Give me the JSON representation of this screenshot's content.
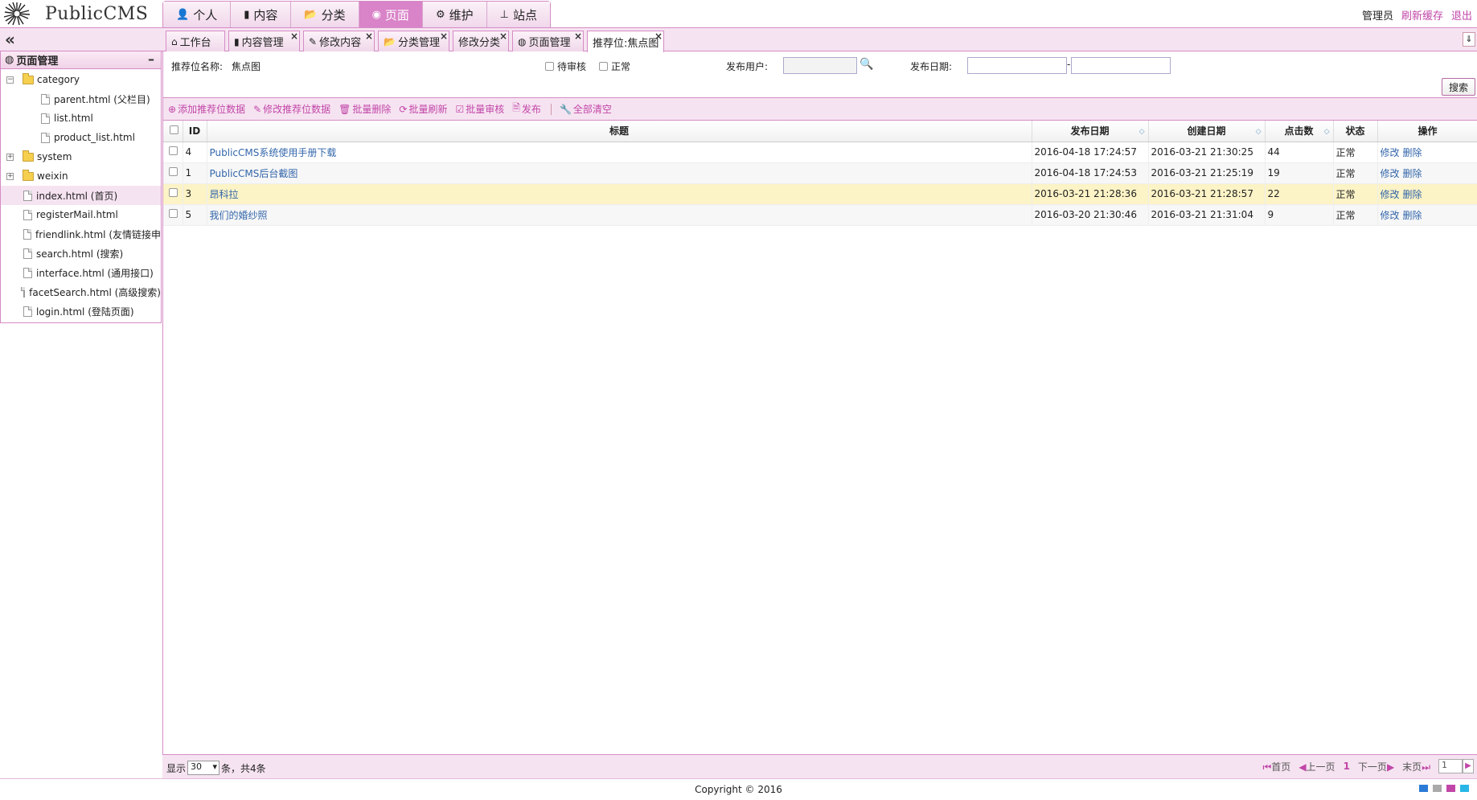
{
  "app": {
    "logo_text": "PublicCMS"
  },
  "topnav": [
    {
      "label": "个人",
      "icon": "user-icon"
    },
    {
      "label": "内容",
      "icon": "book-icon"
    },
    {
      "label": "分类",
      "icon": "folder-open-icon"
    },
    {
      "label": "页面",
      "icon": "globe-icon",
      "active": true
    },
    {
      "label": "维护",
      "icon": "gear-icon"
    },
    {
      "label": "站点",
      "icon": "sitemap-icon"
    }
  ],
  "user_links": {
    "name": "管理员",
    "refresh": "刷新缓存",
    "logout": "退出"
  },
  "tabs": [
    {
      "label": "工作台",
      "icon": "home-icon"
    },
    {
      "label": "内容管理",
      "icon": "book-icon"
    },
    {
      "label": "修改内容",
      "icon": "edit-icon"
    },
    {
      "label": "分类管理",
      "icon": "folder-open-icon"
    },
    {
      "label": "修改分类",
      "icon": ""
    },
    {
      "label": "页面管理",
      "icon": "globe-icon"
    },
    {
      "label": "推荐位:焦点图",
      "icon": "",
      "active": true
    }
  ],
  "sidebar": {
    "title": "页面管理",
    "tree": [
      {
        "label": "category",
        "type": "folder",
        "expanded": true
      },
      {
        "label": "parent.html (父栏目)",
        "type": "file"
      },
      {
        "label": "list.html",
        "type": "file"
      },
      {
        "label": "product_list.html",
        "type": "file"
      },
      {
        "label": "system",
        "type": "folder",
        "expanded": false
      },
      {
        "label": "weixin",
        "type": "folder",
        "expanded": false
      },
      {
        "label": "index.html (首页)",
        "type": "file",
        "selected": true
      },
      {
        "label": "registerMail.html",
        "type": "file"
      },
      {
        "label": "friendlink.html (友情链接申",
        "type": "file"
      },
      {
        "label": "search.html (搜索)",
        "type": "file"
      },
      {
        "label": "interface.html (通用接口)",
        "type": "file"
      },
      {
        "label": "facetSearch.html (高级搜索)",
        "type": "file"
      },
      {
        "label": "login.html (登陆页面)",
        "type": "file"
      }
    ]
  },
  "search": {
    "position_label": "推荐位名称:",
    "position_value": "焦点图",
    "check_pending": "待审核",
    "check_normal": "正常",
    "user_label": "发布用户:",
    "date_label": "发布日期:",
    "date_sep": "-",
    "button": "搜索"
  },
  "toolbar": {
    "add": "添加推荐位数据",
    "edit": "修改推荐位数据",
    "batch_delete": "批量删除",
    "batch_refresh": "批量刷新",
    "batch_check": "批量审核",
    "publish": "发布",
    "clear_all": "全部清空"
  },
  "grid": {
    "columns": [
      "ID",
      "标题",
      "发布日期",
      "创建日期",
      "点击数",
      "状态",
      "操作"
    ],
    "rows": [
      {
        "id": "4",
        "title": "PublicCMS系统使用手册下载",
        "publish": "2016-04-18 17:24:57",
        "create": "2016-03-21 21:30:25",
        "clicks": "44",
        "status": "正常"
      },
      {
        "id": "1",
        "title": "PublicCMS后台截图",
        "publish": "2016-04-18 17:24:53",
        "create": "2016-03-21 21:25:19",
        "clicks": "19",
        "status": "正常"
      },
      {
        "id": "3",
        "title": "昂科拉",
        "publish": "2016-03-21 21:28:36",
        "create": "2016-03-21 21:28:57",
        "clicks": "22",
        "status": "正常"
      },
      {
        "id": "5",
        "title": "我们的婚纱照",
        "publish": "2016-03-20 21:30:46",
        "create": "2016-03-21 21:31:04",
        "clicks": "9",
        "status": "正常"
      }
    ],
    "op_edit": "修改",
    "op_delete": "删除"
  },
  "pager": {
    "show": "显示",
    "page_size": "30",
    "summary": "条，共4条",
    "first": "首页",
    "prev": "上一页",
    "current": "1",
    "next": "下一页",
    "last": "末页",
    "page_input": "1"
  },
  "footer": {
    "copyright": "Copyright © 2016"
  },
  "colors": {
    "accent": "#c146a8",
    "bar_bg": "#f6e3f1",
    "border": "#d58cc6",
    "highlight_row": "#fcf3c6",
    "link": "#3366aa"
  }
}
